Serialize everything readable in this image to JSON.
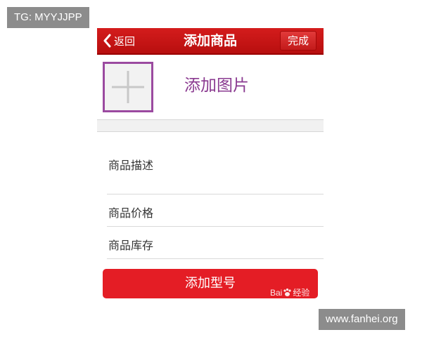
{
  "watermarks": {
    "top": "TG: MYYJJPP",
    "bottom": "www.fanhei.org"
  },
  "navbar": {
    "back_label": "返回",
    "title": "添加商品",
    "done_label": "完成"
  },
  "image_section": {
    "add_image_label": "添加图片"
  },
  "form": {
    "description_label": "商品描述",
    "price_label": "商品价格",
    "stock_label": "商品库存"
  },
  "add_model_button": "添加型号",
  "baidu_watermark": {
    "left": "Bai",
    "right": "经验"
  },
  "colors": {
    "navbar": "#c8141a",
    "button": "#e41d25",
    "image_border": "#9b4aa0",
    "image_label": "#8a3a90"
  }
}
